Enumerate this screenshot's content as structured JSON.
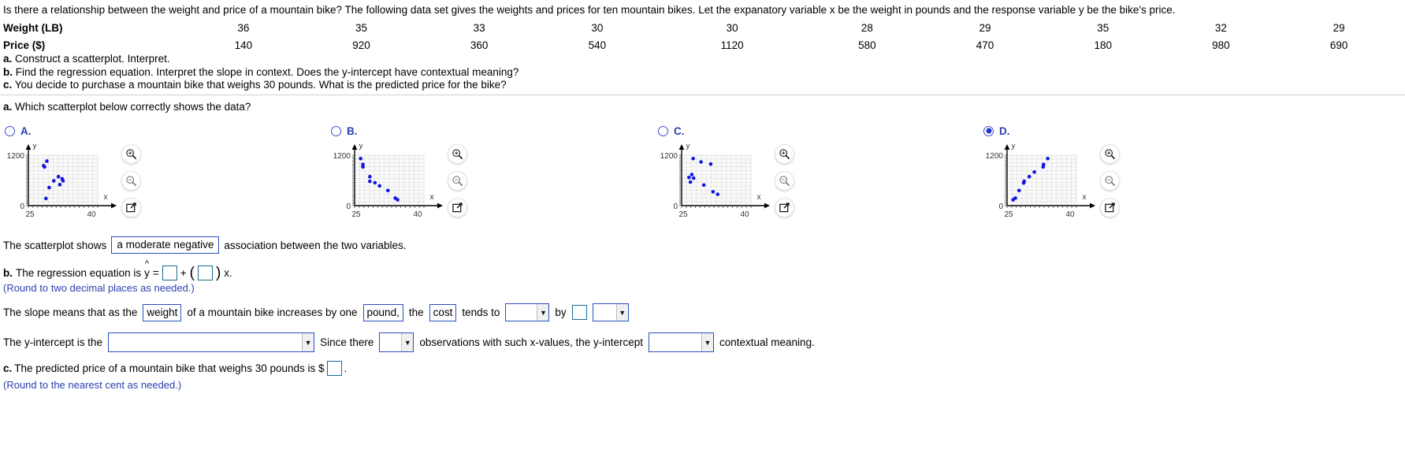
{
  "problem": {
    "statement": "Is there a relationship between the weight and price of a mountain bike? The following data set gives the weights and prices for ten mountain bikes. Let the expanatory variable x be the weight in pounds and the response variable y be the bike's price.",
    "table": {
      "row_labels": [
        "Weight (LB)",
        "Price ($)"
      ],
      "weights": [
        "36",
        "35",
        "33",
        "30",
        "30",
        "28",
        "29",
        "35",
        "32",
        "29"
      ],
      "prices": [
        "140",
        "920",
        "360",
        "540",
        "1120",
        "580",
        "470",
        "180",
        "980",
        "690"
      ]
    },
    "parts": [
      {
        "tag": "a.",
        "text": "Construct a scatterplot. Interpret."
      },
      {
        "tag": "b.",
        "text": "Find the regression equation. Interpret the slope in context. Does the y-intercept have contextual meaning?"
      },
      {
        "tag": "c.",
        "text": "You decide to purchase a mountain bike that weighs 30 pounds. What is the predicted price for the bike?"
      }
    ]
  },
  "question_a": {
    "tag": "a.",
    "text": "Which scatterplot below correctly shows the data?",
    "choices": [
      {
        "letter": "A.",
        "selected": false
      },
      {
        "letter": "B.",
        "selected": false
      },
      {
        "letter": "C.",
        "selected": false
      },
      {
        "letter": "D.",
        "selected": true
      }
    ],
    "plot_tools": [
      "zoom-in-icon",
      "zoom-out-icon",
      "open-popup-icon"
    ]
  },
  "chart_data": [
    {
      "id": "A",
      "type": "scatter",
      "xlabel": "x",
      "ylabel": "y",
      "xlim": [
        25,
        40
      ],
      "ylim": [
        0,
        1200
      ],
      "xticks": [
        "25",
        "40"
      ],
      "yticks": [
        "0",
        "1200"
      ],
      "grid": true,
      "points": [
        {
          "x": 29,
          "y": 1060
        },
        {
          "x": 28.3,
          "y": 950
        },
        {
          "x": 28.5,
          "y": 920
        },
        {
          "x": 31.5,
          "y": 690
        },
        {
          "x": 30.5,
          "y": 590
        },
        {
          "x": 32.3,
          "y": 640
        },
        {
          "x": 32.5,
          "y": 590
        },
        {
          "x": 31.8,
          "y": 500
        },
        {
          "x": 29.5,
          "y": 430
        },
        {
          "x": 28.8,
          "y": 170
        }
      ]
    },
    {
      "id": "B",
      "type": "scatter",
      "xlabel": "x",
      "ylabel": "y",
      "xlim": [
        25,
        40
      ],
      "ylim": [
        0,
        1200
      ],
      "xticks": [
        "25",
        "40"
      ],
      "yticks": [
        "0",
        "1200"
      ],
      "grid": true,
      "points": [
        {
          "x": 26.3,
          "y": 1120
        },
        {
          "x": 26.8,
          "y": 980
        },
        {
          "x": 26.8,
          "y": 920
        },
        {
          "x": 28.3,
          "y": 690
        },
        {
          "x": 28.3,
          "y": 580
        },
        {
          "x": 29.4,
          "y": 545
        },
        {
          "x": 30.4,
          "y": 470
        },
        {
          "x": 32.2,
          "y": 360
        },
        {
          "x": 33.8,
          "y": 180
        },
        {
          "x": 34.3,
          "y": 140
        }
      ]
    },
    {
      "id": "C",
      "type": "scatter",
      "xlabel": "x",
      "ylabel": "y",
      "xlim": [
        25,
        40
      ],
      "ylim": [
        0,
        1200
      ],
      "xticks": [
        "25",
        "40"
      ],
      "yticks": [
        "0",
        "1200"
      ],
      "grid": true,
      "points": [
        {
          "x": 27.5,
          "y": 1120
        },
        {
          "x": 29.2,
          "y": 1040
        },
        {
          "x": 31.3,
          "y": 990
        },
        {
          "x": 27.2,
          "y": 740
        },
        {
          "x": 26.6,
          "y": 670
        },
        {
          "x": 27.6,
          "y": 655
        },
        {
          "x": 26.9,
          "y": 560
        },
        {
          "x": 29.8,
          "y": 490
        },
        {
          "x": 31.8,
          "y": 330
        },
        {
          "x": 32.8,
          "y": 270
        }
      ]
    },
    {
      "id": "D",
      "type": "scatter",
      "xlabel": "x",
      "ylabel": "y",
      "xlim": [
        25,
        40
      ],
      "ylim": [
        0,
        1200
      ],
      "xticks": [
        "25",
        "40"
      ],
      "yticks": [
        "0",
        "1200"
      ],
      "grid": true,
      "points": [
        {
          "x": 26.3,
          "y": 140
        },
        {
          "x": 26.8,
          "y": 180
        },
        {
          "x": 27.6,
          "y": 360
        },
        {
          "x": 28.6,
          "y": 540
        },
        {
          "x": 28.7,
          "y": 580
        },
        {
          "x": 29.8,
          "y": 690
        },
        {
          "x": 30.9,
          "y": 800
        },
        {
          "x": 32.8,
          "y": 920
        },
        {
          "x": 32.9,
          "y": 980
        },
        {
          "x": 33.8,
          "y": 1120
        }
      ]
    }
  ],
  "association": {
    "prefix": "The scatterplot shows",
    "answer": "a moderate negative",
    "suffix": "association between the two variables."
  },
  "part_b": {
    "tag": "b.",
    "prefix": "The regression equation is",
    "yhat": "y",
    "equals": "=",
    "plus": "+",
    "x_label": "x.",
    "intercept_value": "",
    "slope_value": "",
    "hint": "(Round to two decimal places as needed.)"
  },
  "slope_sentence": {
    "p1": "The slope means that as the",
    "box1": "weight",
    "p2": "of a mountain bike increases by one",
    "box2": "pound,",
    "p3": "the",
    "box3": "cost",
    "p4": "tends to",
    "dropdown1": "",
    "p5": "by",
    "input1": "",
    "dropdown2": ""
  },
  "yintercept_sentence": {
    "p1": "The y-intercept is the",
    "dropdown1": "",
    "p2": "Since there",
    "dropdown2": "",
    "p3": "observations with such x-values, the y-intercept",
    "dropdown3": "",
    "p4": "contextual meaning."
  },
  "part_c": {
    "tag": "c.",
    "prefix": "The predicted price of a mountain bike that weighs 30 pounds is $",
    "value": "",
    "suffix": ".",
    "hint": "(Round to the nearest cent as needed.)"
  },
  "colors": {
    "point": "#1414dd",
    "accent_blue": "#2a3fb0",
    "input_border": "#1a6b8f",
    "box_border": "#2a4fc0"
  }
}
